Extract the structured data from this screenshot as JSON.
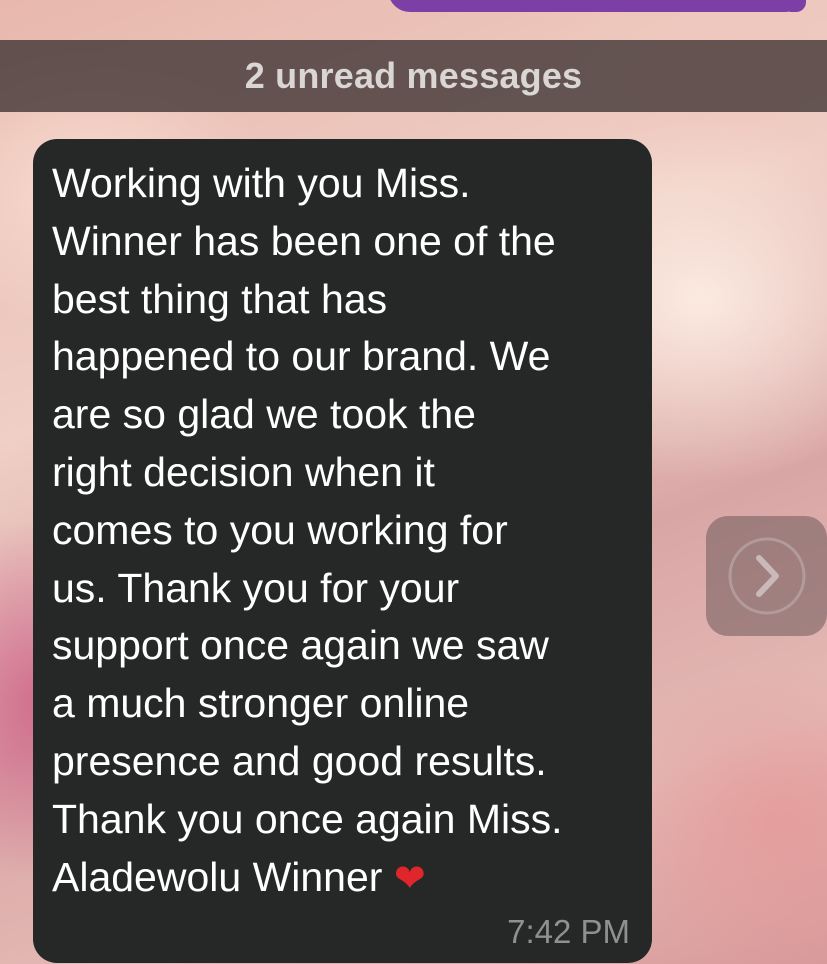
{
  "banner": {
    "unread_label": "2 unread messages"
  },
  "message": {
    "lines": [
      "Working with you Miss.",
      "Winner has been one of the",
      "best thing that has",
      "happened to our brand. We",
      "are so glad we took the",
      "right decision when it",
      "comes to you working for",
      "us. Thank you for your",
      "support once again we saw",
      "a much stronger online",
      "presence and good results.",
      "Thank you once again Miss.",
      "Aladewolu Winner"
    ],
    "emoji": "❤",
    "time": "7:42 PM"
  },
  "icons": {
    "forward": "chevron-right-icon",
    "heart": "heart-icon"
  },
  "colors": {
    "bubble": "#262828",
    "banner": "#3c3232",
    "sent_bubble": "#7b3fa6",
    "heart": "#e0262a"
  }
}
